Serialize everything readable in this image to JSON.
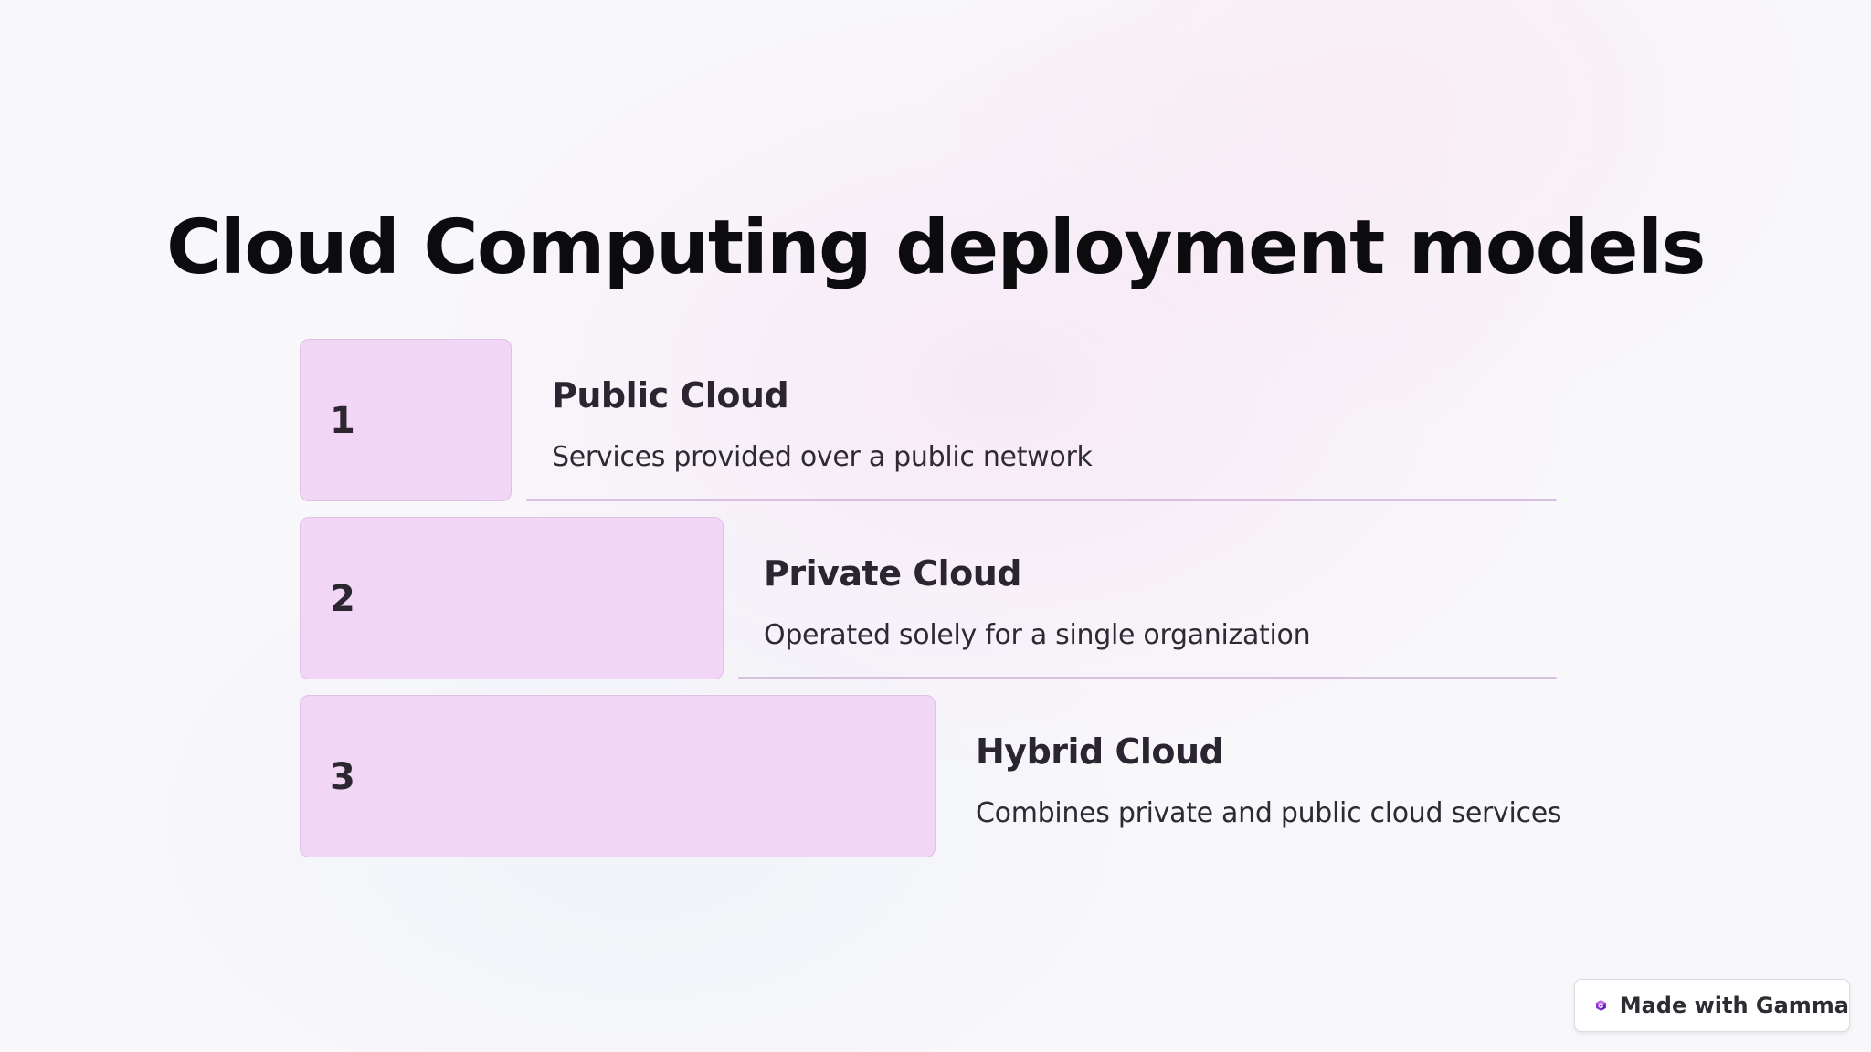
{
  "slide": {
    "title": "Cloud Computing deployment models",
    "steps": [
      {
        "number": "1",
        "heading": "Public Cloud",
        "description": "Services provided over a public network"
      },
      {
        "number": "2",
        "heading": "Private Cloud",
        "description": "Operated solely for a single organization"
      },
      {
        "number": "3",
        "heading": "Hybrid Cloud",
        "description": "Combines private and public cloud services"
      }
    ]
  },
  "badge": {
    "label": "Made with Gamma",
    "icon": "gamma-logo-icon"
  },
  "colors": {
    "step_box": "#f1d6f6",
    "step_rule": "#d9bfe0",
    "title_text": "#0c0c0e",
    "badge_icon": "#8a3ad8"
  }
}
